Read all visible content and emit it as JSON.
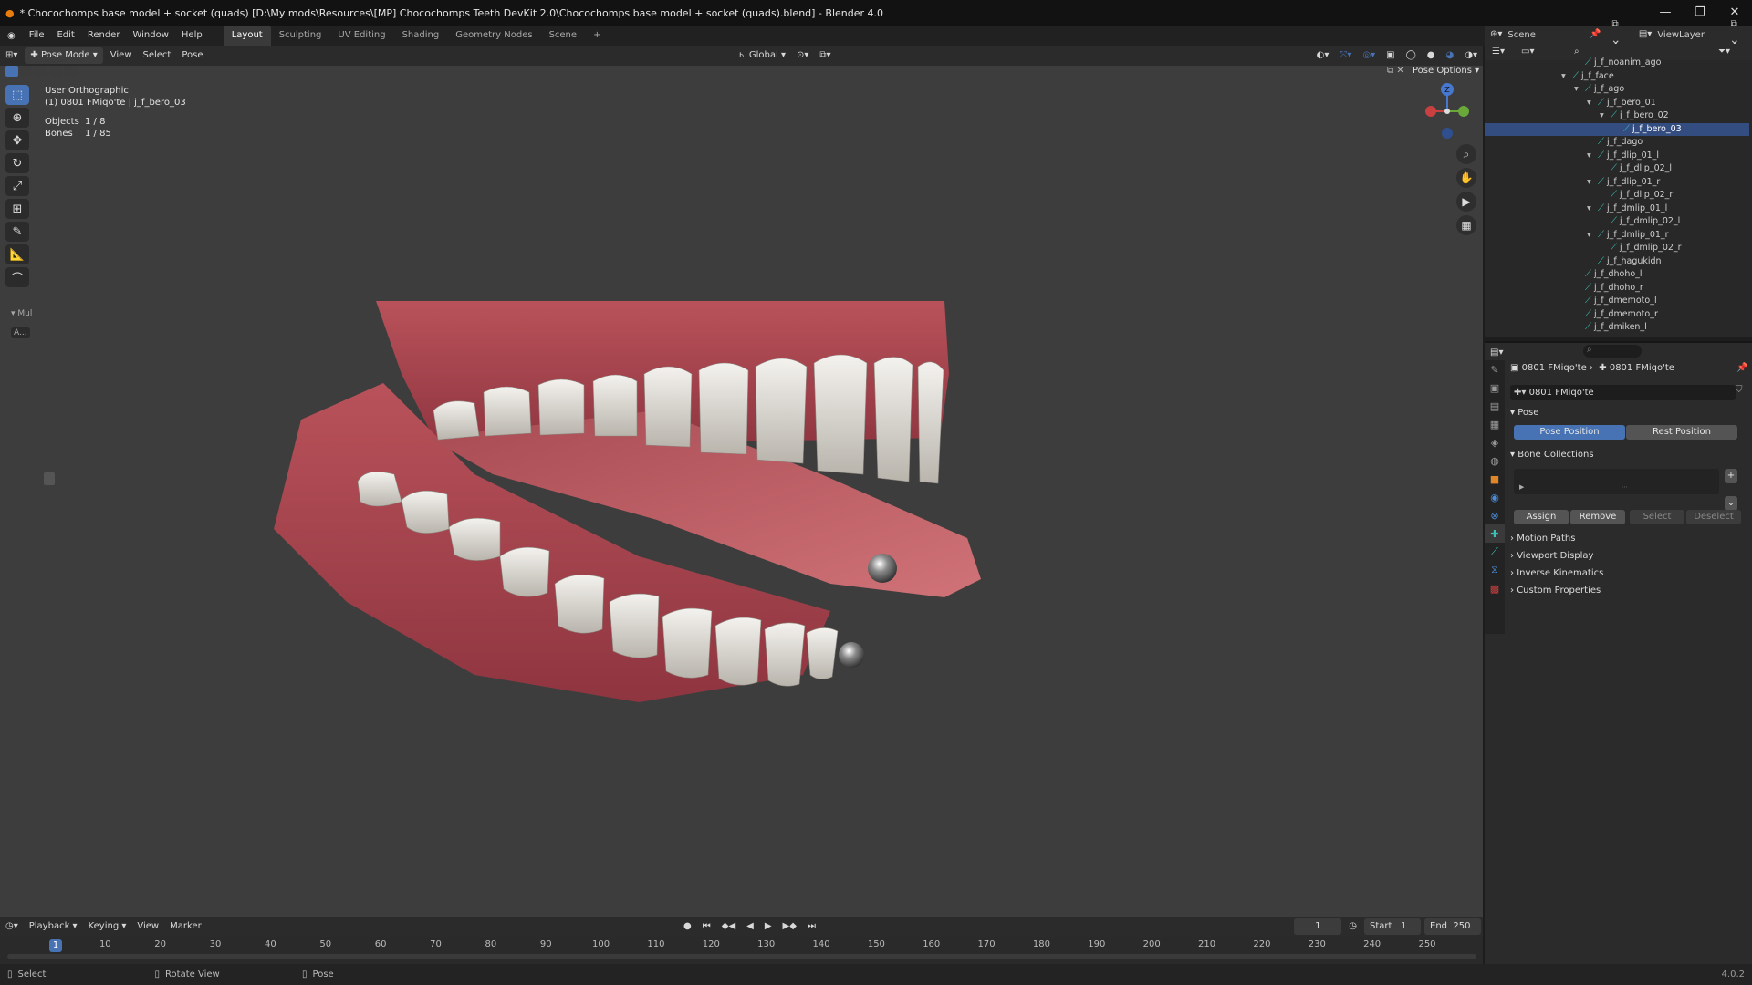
{
  "window": {
    "title": "* Chocochomps base model + socket (quads) [D:\\My mods\\Resources\\[MP] Chocochomps Teeth DevKit 2.0\\Chocochomps base model + socket (quads).blend] - Blender 4.0",
    "controls": [
      "—",
      "❐",
      "✕"
    ]
  },
  "menubar": {
    "items": [
      "File",
      "Edit",
      "Render",
      "Window",
      "Help"
    ],
    "workspaces": [
      "Layout",
      "Sculpting",
      "UV Editing",
      "Shading",
      "Geometry Nodes",
      "Scene"
    ],
    "active_workspace": "Layout",
    "add_tab": "+"
  },
  "viewport_header": {
    "mode": "Pose Mode",
    "menus": [
      "View",
      "Select",
      "Pose"
    ],
    "transform_orientation": "Global",
    "pose_options": "Pose Options"
  },
  "viewport_overlay": {
    "view_name": "User Orthographic",
    "context": "(1) 0801 FMiqo'te | j_f_bero_03",
    "objects_label": "Objects",
    "objects_value": "1 / 8",
    "bones_label": "Bones",
    "bones_value": "1 / 85",
    "redo_panel": "Mul",
    "redo_field": "A..."
  },
  "gizmo": {
    "z_label": "Z"
  },
  "timeline": {
    "menus": [
      "Playback",
      "Keying",
      "View",
      "Marker"
    ],
    "current_frame": "1",
    "start_label": "Start",
    "start_value": "1",
    "end_label": "End",
    "end_value": "250",
    "cursor_frame": "1",
    "ticks": [
      "10",
      "20",
      "30",
      "40",
      "50",
      "60",
      "70",
      "80",
      "90",
      "100",
      "110",
      "120",
      "130",
      "140",
      "150",
      "160",
      "170",
      "180",
      "190",
      "200",
      "210",
      "220",
      "230",
      "240",
      "250"
    ]
  },
  "statusbar": {
    "items": [
      "Select",
      "Rotate View",
      "Pose"
    ],
    "version": "4.0.2"
  },
  "outliner": {
    "scene_label": "Scene",
    "view_layer_label": "ViewLayer",
    "rows": [
      {
        "name": "j_f_noanim_ago",
        "indent": 7,
        "expand": ""
      },
      {
        "name": "j_f_face",
        "indent": 6,
        "expand": "▾"
      },
      {
        "name": "j_f_ago",
        "indent": 7,
        "expand": "▾"
      },
      {
        "name": "j_f_bero_01",
        "indent": 8,
        "expand": "▾"
      },
      {
        "name": "j_f_bero_02",
        "indent": 9,
        "expand": "▾"
      },
      {
        "name": "j_f_bero_03",
        "indent": 10,
        "expand": "",
        "selected": true
      },
      {
        "name": "j_f_dago",
        "indent": 8,
        "expand": ""
      },
      {
        "name": "j_f_dlip_01_l",
        "indent": 8,
        "expand": "▾"
      },
      {
        "name": "j_f_dlip_02_l",
        "indent": 9,
        "expand": ""
      },
      {
        "name": "j_f_dlip_01_r",
        "indent": 8,
        "expand": "▾"
      },
      {
        "name": "j_f_dlip_02_r",
        "indent": 9,
        "expand": ""
      },
      {
        "name": "j_f_dmlip_01_l",
        "indent": 8,
        "expand": "▾"
      },
      {
        "name": "j_f_dmlip_02_l",
        "indent": 9,
        "expand": ""
      },
      {
        "name": "j_f_dmlip_01_r",
        "indent": 8,
        "expand": "▾"
      },
      {
        "name": "j_f_dmlip_02_r",
        "indent": 9,
        "expand": ""
      },
      {
        "name": "j_f_hagukidn",
        "indent": 8,
        "expand": ""
      },
      {
        "name": "j_f_dhoho_l",
        "indent": 7,
        "expand": ""
      },
      {
        "name": "j_f_dhoho_r",
        "indent": 7,
        "expand": ""
      },
      {
        "name": "j_f_dmemoto_l",
        "indent": 7,
        "expand": ""
      },
      {
        "name": "j_f_dmemoto_r",
        "indent": 7,
        "expand": ""
      },
      {
        "name": "j_f_dmiken_l",
        "indent": 7,
        "expand": ""
      }
    ]
  },
  "properties": {
    "breadcrumb_object": "0801 FMiqo'te",
    "breadcrumb_data": "0801 FMiqo'te",
    "armature_name": "0801 FMiqo'te",
    "pose_panel": "Pose",
    "pose_position": "Pose Position",
    "rest_position": "Rest Position",
    "bone_collections": "Bone Collections",
    "assign": "Assign",
    "remove": "Remove",
    "select": "Select",
    "deselect": "Deselect",
    "collapsed_panels": [
      "Motion Paths",
      "Viewport Display",
      "Inverse Kinematics",
      "Custom Properties"
    ]
  },
  "colors": {
    "accent": "#4772b3",
    "bone": "#38c3b6",
    "viewport_bg": "#3d3d3d"
  }
}
